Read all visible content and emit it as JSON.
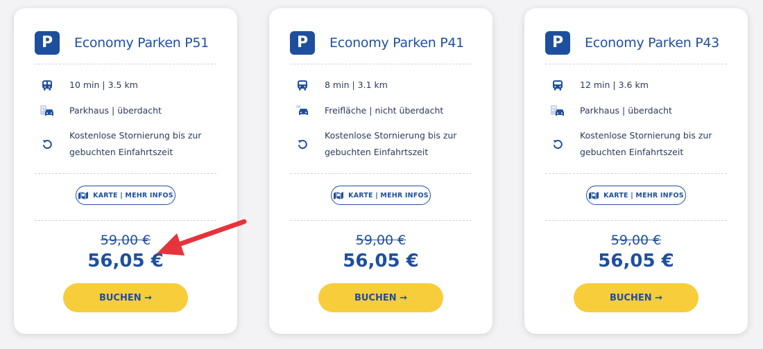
{
  "cards": [
    {
      "badge": "P",
      "title": "Economy Parken P51",
      "transfer": "10 min | 3.5 km",
      "transfer_icon": "train-icon",
      "parking_type": "Parkhaus | überdacht",
      "parking_icon": "parking-garage-car-icon",
      "cancellation": "Kostenlose Stornierung bis zur gebuchten Einfahrtszeit",
      "info_button": "KARTE | MEHR INFOS",
      "old_price": "59,00 €",
      "price": "56,05 €",
      "book_button": "BUCHEN →"
    },
    {
      "badge": "P",
      "title": "Economy Parken P41",
      "transfer": "8 min | 3.1 km",
      "transfer_icon": "bus-icon",
      "parking_type": "Freifläche | nicht überdacht",
      "parking_icon": "outdoor-car-icon",
      "cancellation": "Kostenlose Stornierung bis zur gebuchten Einfahrtszeit",
      "info_button": "KARTE | MEHR INFOS",
      "old_price": "59,00 €",
      "price": "56,05 €",
      "book_button": "BUCHEN →"
    },
    {
      "badge": "P",
      "title": "Economy Parken P43",
      "transfer": "12 min | 3.6 km",
      "transfer_icon": "bus-icon",
      "parking_type": "Parkhaus | überdacht",
      "parking_icon": "parking-garage-car-icon",
      "cancellation": "Kostenlose Stornierung bis zur gebuchten Einfahrtszeit",
      "info_button": "KARTE | MEHR INFOS",
      "old_price": "59,00 €",
      "price": "56,05 €",
      "book_button": "BUCHEN →"
    }
  ],
  "colors": {
    "brand_blue": "#1e4f9e",
    "button_yellow": "#f7cd3c",
    "annotation_red": "#e5343b"
  }
}
